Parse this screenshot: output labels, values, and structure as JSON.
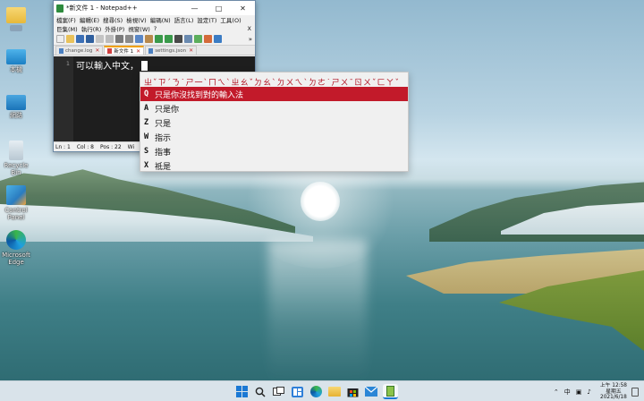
{
  "desktop": {
    "icons": [
      {
        "label": "",
        "icon": "folder-icon"
      },
      {
        "label": "本機",
        "icon": "this-pc-icon"
      },
      {
        "label": "網路",
        "icon": "network-icon"
      },
      {
        "label": "Recycle Bin",
        "icon": "recycle-bin-icon"
      },
      {
        "label": "Control Panel",
        "icon": "control-panel-icon"
      },
      {
        "label": "Microsoft Edge",
        "icon": "edge-icon"
      }
    ]
  },
  "notepad": {
    "title": "*新文件 1 - Notepad++",
    "menu_row1": [
      "檔案(F)",
      "編輯(E)",
      "搜尋(S)",
      "檢視(V)",
      "編碼(N)",
      "語言(L)",
      "設定(T)",
      "工具(O)"
    ],
    "menu_row2": [
      "巨集(M)",
      "執行(R)",
      "外掛(P)",
      "視窗(W)",
      "?"
    ],
    "menu_close": "X",
    "tabs": [
      {
        "label": "change.log",
        "active": false
      },
      {
        "label": "新文件 1",
        "active": true
      },
      {
        "label": "settings.json",
        "active": false
      }
    ],
    "line_number": "1",
    "content": "可以輸入中文，",
    "status": {
      "ln": "Ln : 1",
      "col": "Col : 8",
      "pos": "Pos : 22",
      "extra": "Wi"
    }
  },
  "ime": {
    "composition": "ㄓˇㄗˊㄋ˙ㄕ一ˋㄇㄟˋㄓㄠˇㄉㄠˋㄉㄨㄟˋㄉㄜ˙ㄕㄨˉㄖㄨˇㄈㄚˇ",
    "candidates": [
      {
        "key": "Q",
        "text": "只是你沒找到對的輸入法",
        "selected": true
      },
      {
        "key": "A",
        "text": "只是你",
        "selected": false
      },
      {
        "key": "Z",
        "text": "只是",
        "selected": false
      },
      {
        "key": "W",
        "text": "指示",
        "selected": false
      },
      {
        "key": "S",
        "text": "指事",
        "selected": false
      },
      {
        "key": "X",
        "text": "祗是",
        "selected": false
      }
    ]
  },
  "taskbar": {
    "apps": [
      "windows-start-icon",
      "search-icon",
      "task-view-icon",
      "widgets-icon",
      "edge-icon",
      "file-explorer-icon",
      "store-icon",
      "mail-icon",
      "notepadpp-icon"
    ],
    "tray_ime": "中",
    "time": "上午 12:58",
    "weekday": "星期五",
    "date": "2021/6/18"
  }
}
